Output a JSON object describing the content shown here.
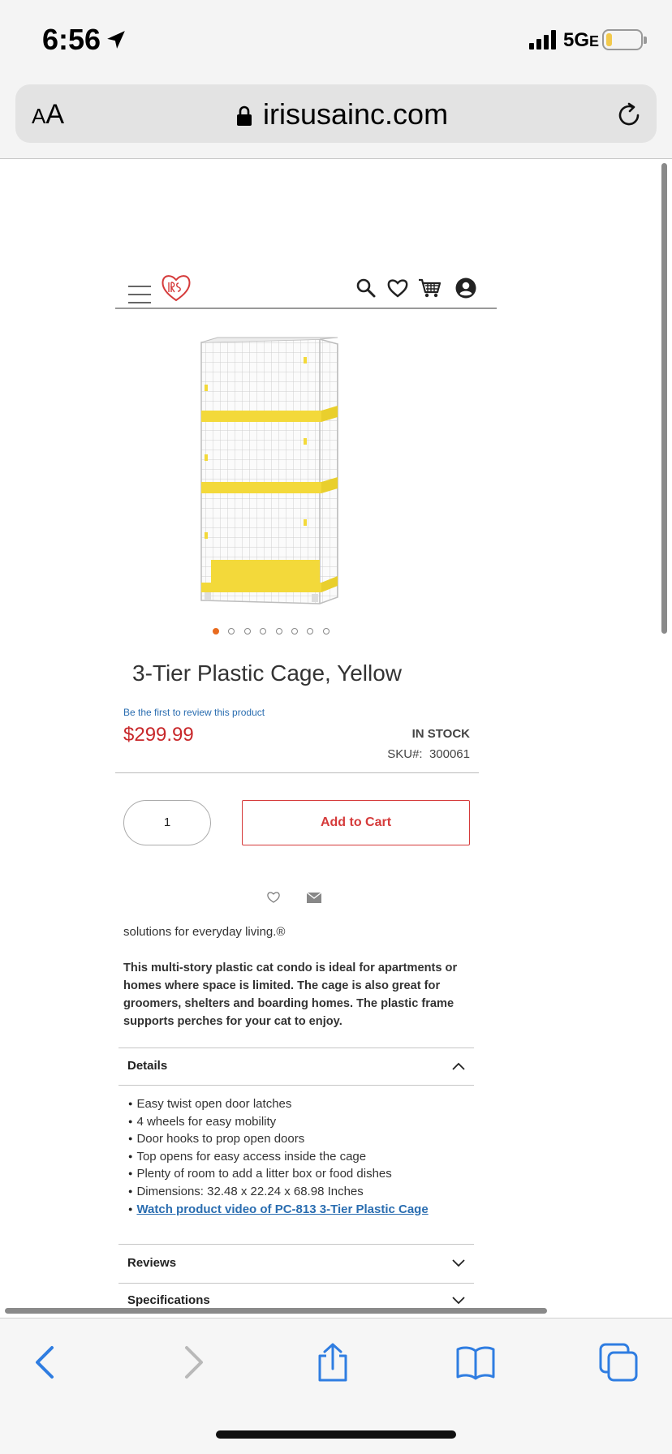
{
  "status": {
    "time": "6:56",
    "network": "5G",
    "network_suffix": "E"
  },
  "browser": {
    "text_size": [
      "A",
      "A"
    ],
    "host": "irisusainc.com"
  },
  "product": {
    "title": "3-Tier Plastic Cage, Yellow",
    "review_link": "Be the first to review this product",
    "price": "$299.99",
    "stock": "IN STOCK",
    "sku_label": "SKU#:",
    "sku": "300061",
    "quantity": "1",
    "add_to_cart": "Add to Cart",
    "gallery_count": 8,
    "gallery_active": 1,
    "tagline": "solutions for everyday living.®",
    "description": "This multi-story plastic cat condo is ideal for apartments or homes where space is limited. The cage is also great for groomers, shelters and boarding homes. The plastic frame supports perches for your cat to enjoy."
  },
  "accordion": {
    "details": {
      "label": "Details",
      "items": [
        "Easy twist open door latches",
        "4 wheels for easy mobility",
        "Door hooks to prop open doors",
        "Top opens for easy access inside the cage",
        "Plenty of room to add a litter box or food dishes",
        "Dimensions: 32.48 x 22.24 x 68.98 Inches"
      ],
      "video_link": "Watch product video of PC-813 3-Tier Plastic Cage"
    },
    "reviews": {
      "label": "Reviews"
    },
    "specifications": {
      "label": "Specifications"
    }
  },
  "colors": {
    "accent": "#d53a3a",
    "price": "#c8282b",
    "link": "#2a6db0",
    "active_dot": "#e86b1f",
    "cage_yellow": "#f3d93a"
  },
  "icons": {
    "header": [
      "menu-icon",
      "iris-logo",
      "search-icon",
      "wishlist-heart-icon",
      "cart-icon",
      "account-icon"
    ],
    "toolbar": [
      "back-icon",
      "forward-icon",
      "share-icon",
      "bookmarks-icon",
      "tabs-icon"
    ]
  }
}
